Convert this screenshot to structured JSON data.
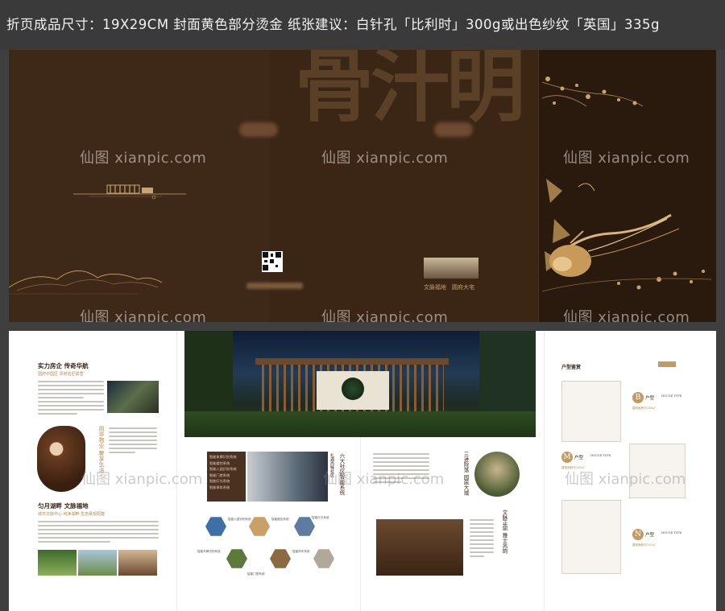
{
  "spec_bar": {
    "text": "折页成品尺寸：19X29CM  封面黄色部分烫金   纸张建议：白针孔「比利时」300g或出色纱纹「英国」335g"
  },
  "watermark": "仙图 xianpic.com",
  "cover": {
    "big_title": "骨汁明",
    "tagline": "文脉福地　圆府大宅"
  },
  "inner": {
    "section1_title": "实力房企 传奇华航",
    "section1_sub": "国府中国区 贵府名匠联营",
    "vertical_title": "用华物业 奢享生活",
    "section2_title": "匀月湖畔 文脉福地",
    "section2_sub": "城市文脉中心 纯净湖畔 生态景观配套",
    "vertical_six": "六大社区智能系统",
    "vertical_six_sub": "礼遇尚臻社区",
    "menu_items": [
      "智能车牌识别系统",
      "智能楼控系统",
      "智能入园识别系统",
      "智能门禁系统",
      "智能灯光系统",
      "智能停车系统"
    ],
    "hex_labels": [
      "智能入园识别系统",
      "智能楼控系统",
      "智能灯光系统",
      "智能车牌识别系统",
      "智能门禁系统",
      "智能停车系统"
    ],
    "vertical_courtyard": "三进院落 园居大城",
    "vertical_culture": "文脉正鼎 雅士风韵",
    "house_types_title": "户型鉴赏",
    "plans": [
      {
        "letter": "B",
        "name": "户型",
        "en": "HOUSE TYPE",
        "area": "建筑面积约128㎡"
      },
      {
        "letter": "M",
        "name": "户型",
        "en": "HOUSE TYPE",
        "area": "建筑面积约133㎡"
      },
      {
        "letter": "N",
        "name": "户型",
        "en": "HOUSE TYPE",
        "area": "建筑面积约115㎡"
      }
    ]
  },
  "colors": {
    "cover_brown": "#3b2616",
    "gold": "#c8a470",
    "inner_bg": "#ffffff",
    "spec_bar_bg": "#3a3a3a"
  }
}
